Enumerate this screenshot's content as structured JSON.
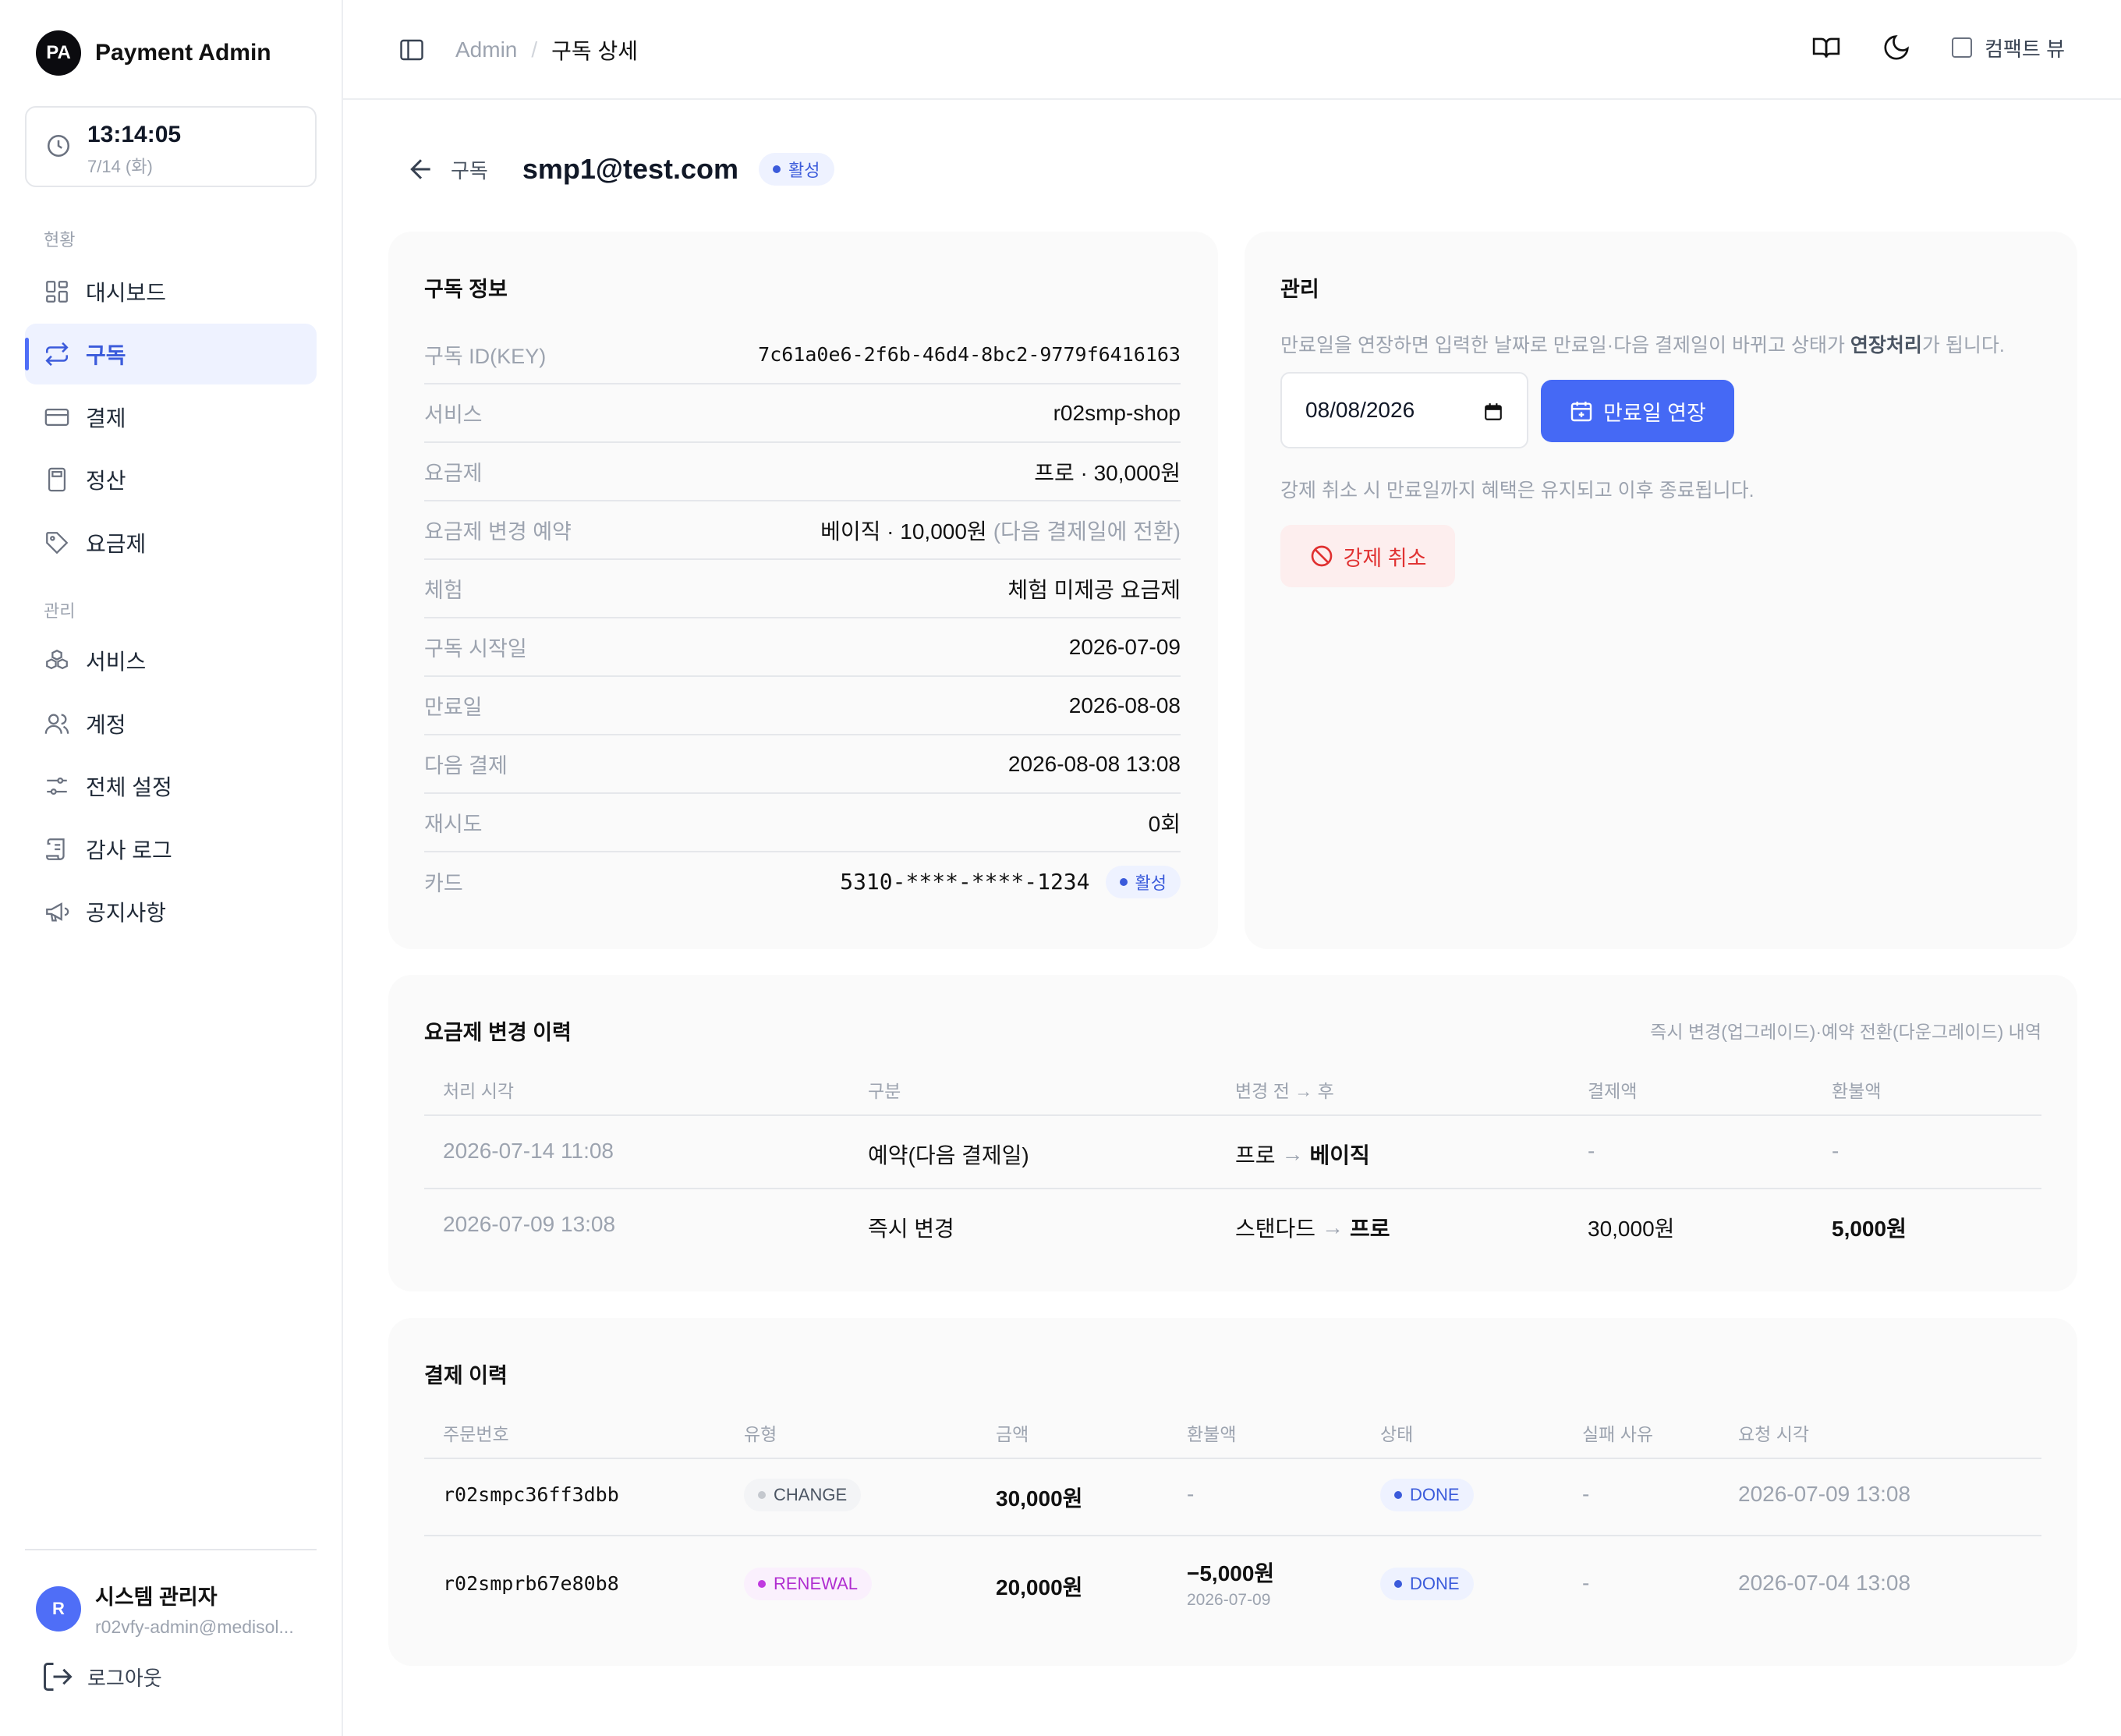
{
  "brand": {
    "logo": "PA",
    "name": "Payment Admin"
  },
  "clock": {
    "time": "13:14:05",
    "date": "7/14 (화)"
  },
  "sidebar": {
    "section_status": "현황",
    "section_manage": "관리",
    "items": [
      {
        "label": "대시보드",
        "icon": "dashboard-icon"
      },
      {
        "label": "구독",
        "icon": "repeat-icon",
        "active": true
      },
      {
        "label": "결제",
        "icon": "credit-card-icon"
      },
      {
        "label": "정산",
        "icon": "calculator-icon"
      },
      {
        "label": "요금제",
        "icon": "tag-icon"
      },
      {
        "label": "서비스",
        "icon": "boxes-icon"
      },
      {
        "label": "계정",
        "icon": "users-icon"
      },
      {
        "label": "전체 설정",
        "icon": "sliders-icon"
      },
      {
        "label": "감사 로그",
        "icon": "scroll-icon"
      },
      {
        "label": "공지사항",
        "icon": "megaphone-icon"
      }
    ]
  },
  "user": {
    "avatar": "R",
    "name": "시스템 관리자",
    "email": "r02vfy-admin@medisol..."
  },
  "logout_label": "로그아웃",
  "header": {
    "breadcrumb": [
      "Admin",
      "/",
      "구독 상세"
    ],
    "compact_label": "컴팩트 뷰"
  },
  "page": {
    "back_label": "구독",
    "title": "smp1@test.com",
    "status": "활성"
  },
  "info": {
    "title": "구독 정보",
    "rows": [
      {
        "k": "구독 ID(KEY)",
        "v": "7c61a0e6-2f6b-46d4-8bc2-9779f6416163"
      },
      {
        "k": "서비스",
        "v": "r02smp-shop"
      },
      {
        "k": "요금제",
        "v": "프로 · 30,000원"
      },
      {
        "k": "요금제 변경 예약",
        "v": "베이직 · 10,000원",
        "v_note": "(다음 결제일에 전환)"
      },
      {
        "k": "체험",
        "v": "체험 미제공 요금제"
      },
      {
        "k": "구독 시작일",
        "v": "2026-07-09"
      },
      {
        "k": "만료일",
        "v": "2026-08-08"
      },
      {
        "k": "다음 결제",
        "v": "2026-08-08 13:08"
      },
      {
        "k": "재시도",
        "v": "0회"
      },
      {
        "k": "카드",
        "v": "5310-****-****-1234",
        "badge": "활성"
      }
    ]
  },
  "manage": {
    "title": "관리",
    "desc_before": "만료일을 연장하면 입력한 날짜로 만료일·다음 결제일이 바뀌고 상태가 ",
    "desc_bold": "연장처리",
    "desc_after": "가 됩니다.",
    "date_value": "08/08/2026",
    "extend_label": "만료일 연장",
    "cancel_desc": "강제 취소 시 만료일까지 혜택은 유지되고 이후 종료됩니다.",
    "cancel_label": "강제 취소"
  },
  "plan_history": {
    "title": "요금제 변경 이력",
    "note": "즉시 변경(업그레이드)·예약 전환(다운그레이드) 내역",
    "columns": [
      "처리 시각",
      "구분",
      "변경 전 → 후",
      "결제액",
      "환불액"
    ],
    "rows": [
      {
        "time": "2026-07-14 11:08",
        "type": "예약(다음 결제일)",
        "from": "프로",
        "arrow": "→",
        "to": "베이직",
        "paid": "-",
        "refund": "-"
      },
      {
        "time": "2026-07-09 13:08",
        "type": "즉시 변경",
        "from": "스탠다드",
        "arrow": "→",
        "to": "프로",
        "paid": "30,000원",
        "refund": "5,000원"
      }
    ]
  },
  "payments": {
    "title": "결제 이력",
    "columns": [
      "주문번호",
      "유형",
      "금액",
      "환불액",
      "상태",
      "실패 사유",
      "요청 시각"
    ],
    "rows": [
      {
        "order": "r02smpc36ff3dbb",
        "type": "CHANGE",
        "amount": "30,000원",
        "refund": "-",
        "refund_date": "",
        "status": "DONE",
        "fail": "-",
        "requested": "2026-07-09 13:08"
      },
      {
        "order": "r02smprb67e80b8",
        "type": "RENEWAL",
        "amount": "20,000원",
        "refund": "−5,000원",
        "refund_date": "2026-07-09",
        "status": "DONE",
        "fail": "-",
        "requested": "2026-07-04 13:08"
      }
    ]
  },
  "colors": {
    "accent": "#4569f5",
    "danger": "#e03131",
    "active_bg": "#eef2ff",
    "renewal": "#b02ed0"
  }
}
